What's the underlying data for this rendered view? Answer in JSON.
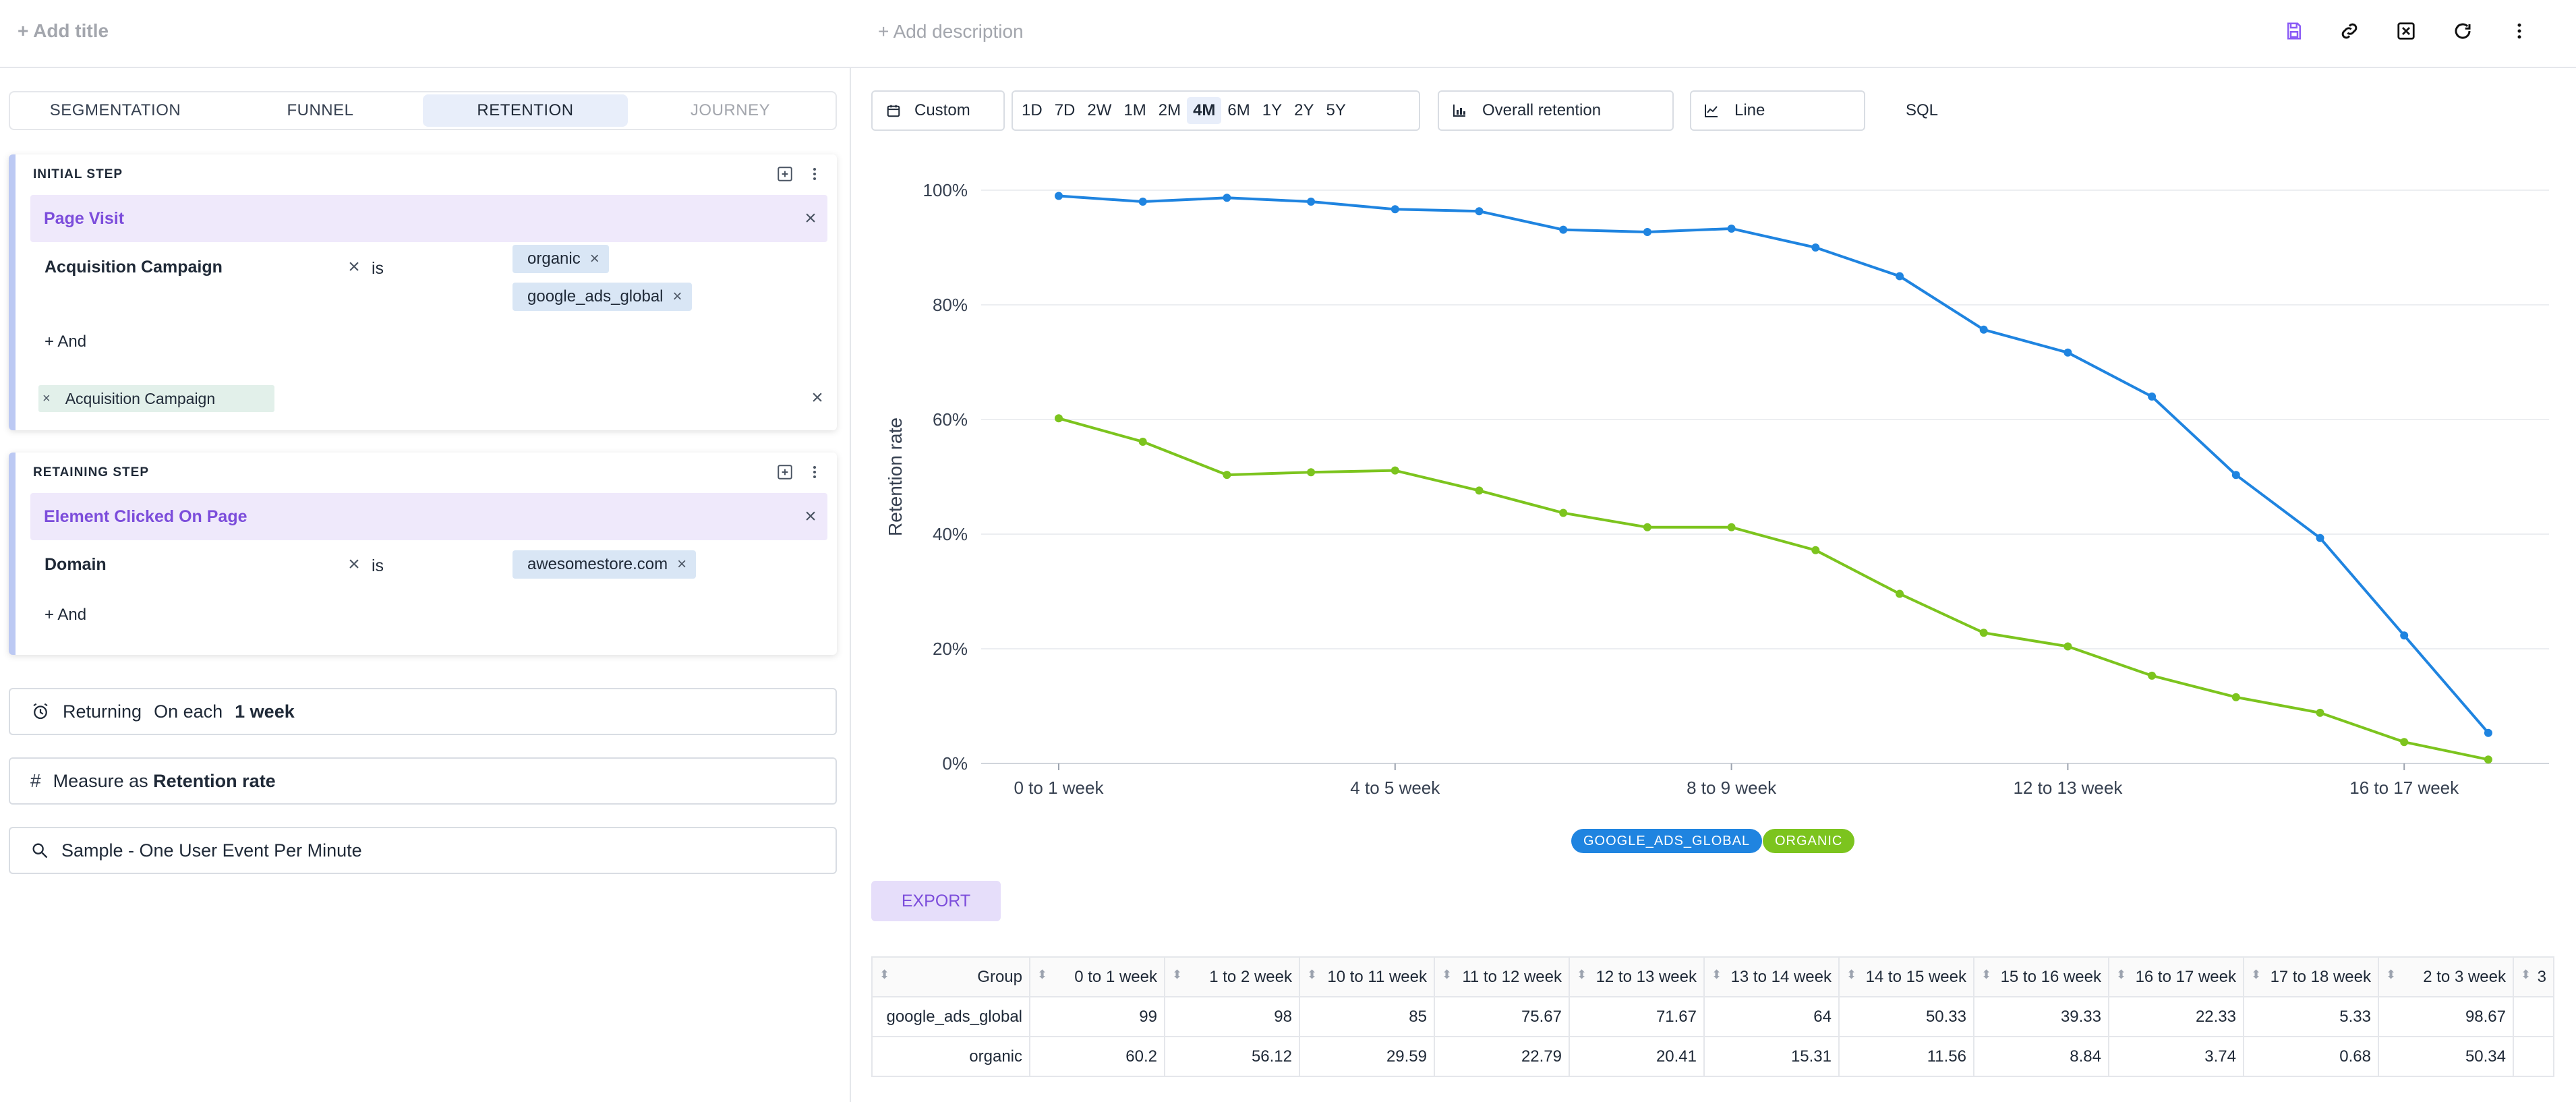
{
  "topbar": {
    "add_title": "+ Add title",
    "add_description": "+ Add description",
    "icons": [
      "save-icon",
      "link-icon",
      "close-box-icon",
      "refresh-icon",
      "more-vertical-icon"
    ]
  },
  "tabs": [
    {
      "label": "SEGMENTATION",
      "state": "normal"
    },
    {
      "label": "FUNNEL",
      "state": "normal"
    },
    {
      "label": "RETENTION",
      "state": "active"
    },
    {
      "label": "JOURNEY",
      "state": "disabled"
    }
  ],
  "initial_step": {
    "heading": "INITIAL STEP",
    "event": "Page Visit",
    "filter": {
      "property": "Acquisition Campaign",
      "operator": "is",
      "values": [
        "organic",
        "google_ads_global"
      ]
    },
    "add_and": "+ And",
    "group_by": "Acquisition Campaign"
  },
  "retaining_step": {
    "heading": "RETAINING STEP",
    "event": "Element Clicked On Page",
    "filter": {
      "property": "Domain",
      "operator": "is",
      "values": [
        "awesomestore.com"
      ]
    },
    "add_and": "+ And"
  },
  "returning": {
    "label": "Returning",
    "mode": "On each",
    "period": "1 week"
  },
  "measure": {
    "label": "Measure as",
    "value": "Retention rate"
  },
  "sample": {
    "label": "Sample - One User Event Per Minute"
  },
  "controls": {
    "date_preset": "Custom",
    "ranges": [
      "1D",
      "7D",
      "2W",
      "1M",
      "2M",
      "4M",
      "6M",
      "1Y",
      "2Y",
      "5Y"
    ],
    "active_range": "4M",
    "metric": "Overall retention",
    "chart_type": "Line",
    "sql": "SQL"
  },
  "chart_data": {
    "type": "line",
    "ylabel": "Retention rate",
    "xlabel": "",
    "ylim": [
      0,
      100
    ],
    "yticks": [
      "0%",
      "20%",
      "40%",
      "60%",
      "80%",
      "100%"
    ],
    "x_tick_labels": [
      {
        "index": 0,
        "label": "0 to 1 week"
      },
      {
        "index": 4,
        "label": "4 to 5 week"
      },
      {
        "index": 8,
        "label": "8 to 9 week"
      },
      {
        "index": 12,
        "label": "12 to 13 week"
      },
      {
        "index": 16,
        "label": "16 to 17 week"
      }
    ],
    "grid": true,
    "legend_position": "bottom-center",
    "series": [
      {
        "name": "GOOGLE_ADS_GLOBAL",
        "color": "#1f84e0",
        "values": [
          99,
          98,
          98.67,
          98,
          96.67,
          96.33,
          93.1,
          92.7,
          93.3,
          90,
          85,
          75.67,
          71.67,
          64,
          50.33,
          39.33,
          22.33,
          5.33
        ]
      },
      {
        "name": "ORGANIC",
        "color": "#7cc41e",
        "values": [
          60.2,
          56.12,
          50.34,
          50.8,
          51.1,
          47.6,
          43.7,
          41.2,
          41.2,
          37.2,
          29.59,
          22.79,
          20.41,
          15.31,
          11.56,
          8.84,
          3.74,
          0.68
        ]
      }
    ]
  },
  "export_label": "EXPORT",
  "table": {
    "group_header": "Group",
    "columns": [
      "0 to 1 week",
      "1 to 2 week",
      "10 to 11 week",
      "11 to 12 week",
      "12 to 13 week",
      "13 to 14 week",
      "14 to 15 week",
      "15 to 16 week",
      "16 to 17 week",
      "17 to 18 week",
      "2 to 3 week",
      "3"
    ],
    "rows": [
      {
        "group": "google_ads_global",
        "values": [
          "99",
          "98",
          "85",
          "75.67",
          "71.67",
          "64",
          "50.33",
          "39.33",
          "22.33",
          "5.33",
          "98.67",
          ""
        ]
      },
      {
        "group": "organic",
        "values": [
          "60.2",
          "56.12",
          "29.59",
          "22.79",
          "20.41",
          "15.31",
          "11.56",
          "8.84",
          "3.74",
          "0.68",
          "50.34",
          ""
        ]
      }
    ]
  }
}
